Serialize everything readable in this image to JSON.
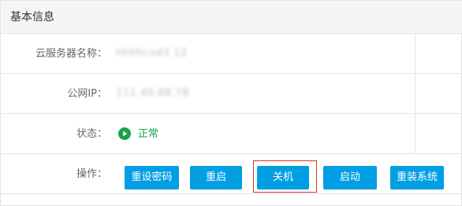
{
  "panel": {
    "title": "基本信息"
  },
  "info": {
    "server_name": {
      "label": "云服务器名称：",
      "value": "hhhhcxd3 12"
    },
    "public_ip": {
      "label": "公网IP：",
      "value": "111.45.88.78"
    },
    "status": {
      "label": "状态：",
      "value": "正常",
      "icon": "play-circle-icon",
      "color": "#1aa24c"
    }
  },
  "operations": {
    "label": "操作：",
    "buttons": {
      "reset_password": "重设密码",
      "restart": "重启",
      "shutdown": "关机",
      "start": "启动",
      "reinstall": "重装系统"
    }
  },
  "colors": {
    "button": "#009fe4",
    "button_text": "#ffffff",
    "border": "#e3e3e3",
    "focus_outline": "#d8322b",
    "status_green": "#1aa24c"
  }
}
